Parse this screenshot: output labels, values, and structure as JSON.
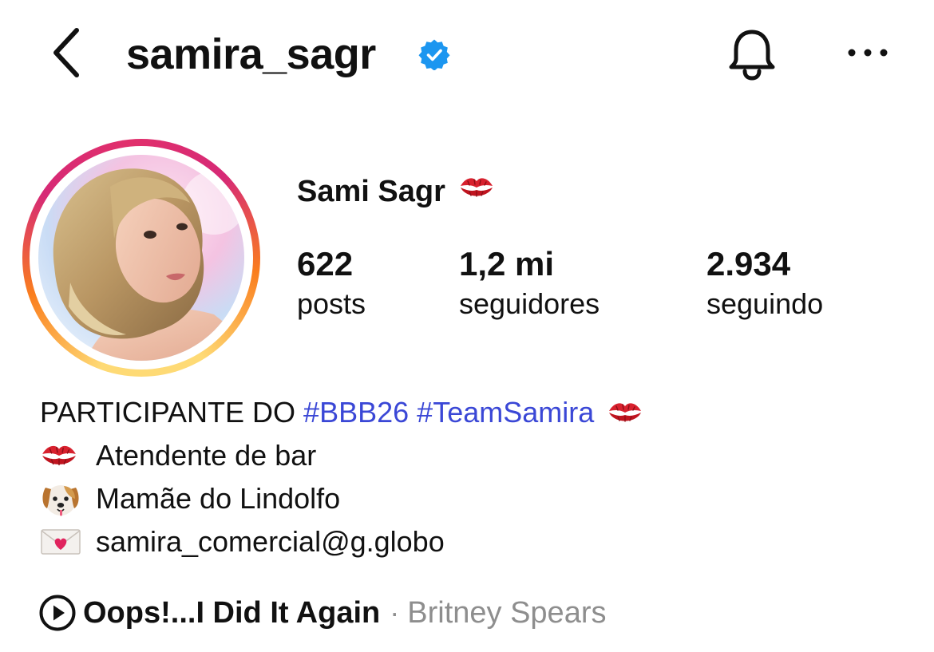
{
  "header": {
    "username": "samira_sagr",
    "verified": true,
    "back_icon": "chevron-left-icon",
    "bell_icon": "bell-icon",
    "more_icon": "more-horizontal-icon"
  },
  "profile": {
    "display_name": "Sami Sagr",
    "name_emoji": "kiss-mark-icon",
    "stats": {
      "posts": {
        "value": "622",
        "label": "posts"
      },
      "followers": {
        "value": "1,2 mi",
        "label": "seguidores"
      },
      "following": {
        "value": "2.934",
        "label": "seguindo"
      }
    }
  },
  "bio": {
    "line1_text": "PARTICIPANTE DO ",
    "hashtag1": "#BBB26",
    "hashtag2": "#TeamSamira",
    "line2_text": "Atendente de bar",
    "line3_text": "Mamãe do Lindolfo",
    "line4_text": "samira_comercial@g.globo",
    "line2_emoji": "kiss-mark-icon",
    "line3_emoji": "dog-face-icon",
    "line4_emoji": "love-letter-icon"
  },
  "music": {
    "song": "Oops!...I Did It Again",
    "separator": "·",
    "artist": "Britney Spears"
  },
  "colors": {
    "hashtag": "#3a47d6",
    "verified": "#1c96f0",
    "secondary_text": "#8e8e8e",
    "story_ring": [
      "#feda75",
      "#fa7e1e",
      "#d62976"
    ]
  }
}
